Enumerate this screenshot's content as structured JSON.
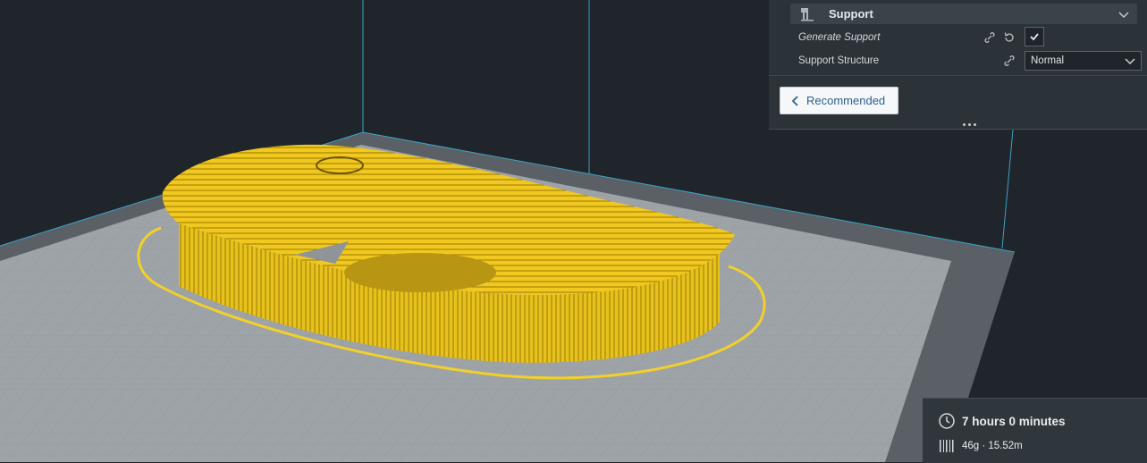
{
  "colors": {
    "background": "#1f252b",
    "model": "#f2d02a",
    "build_plate": "#9ea3a7",
    "panel": "#2b3238",
    "accent_link": "#2d5f8f"
  },
  "settings": {
    "category": {
      "label": "Support",
      "icon": "support-icon"
    },
    "rows": [
      {
        "label": "Generate Support",
        "checked": true
      },
      {
        "label": "Support Structure",
        "value": "Normal"
      }
    ],
    "recommended_button": "Recommended"
  },
  "print_info": {
    "time": "7 hours 0 minutes",
    "material": "46g · 15.52m"
  }
}
